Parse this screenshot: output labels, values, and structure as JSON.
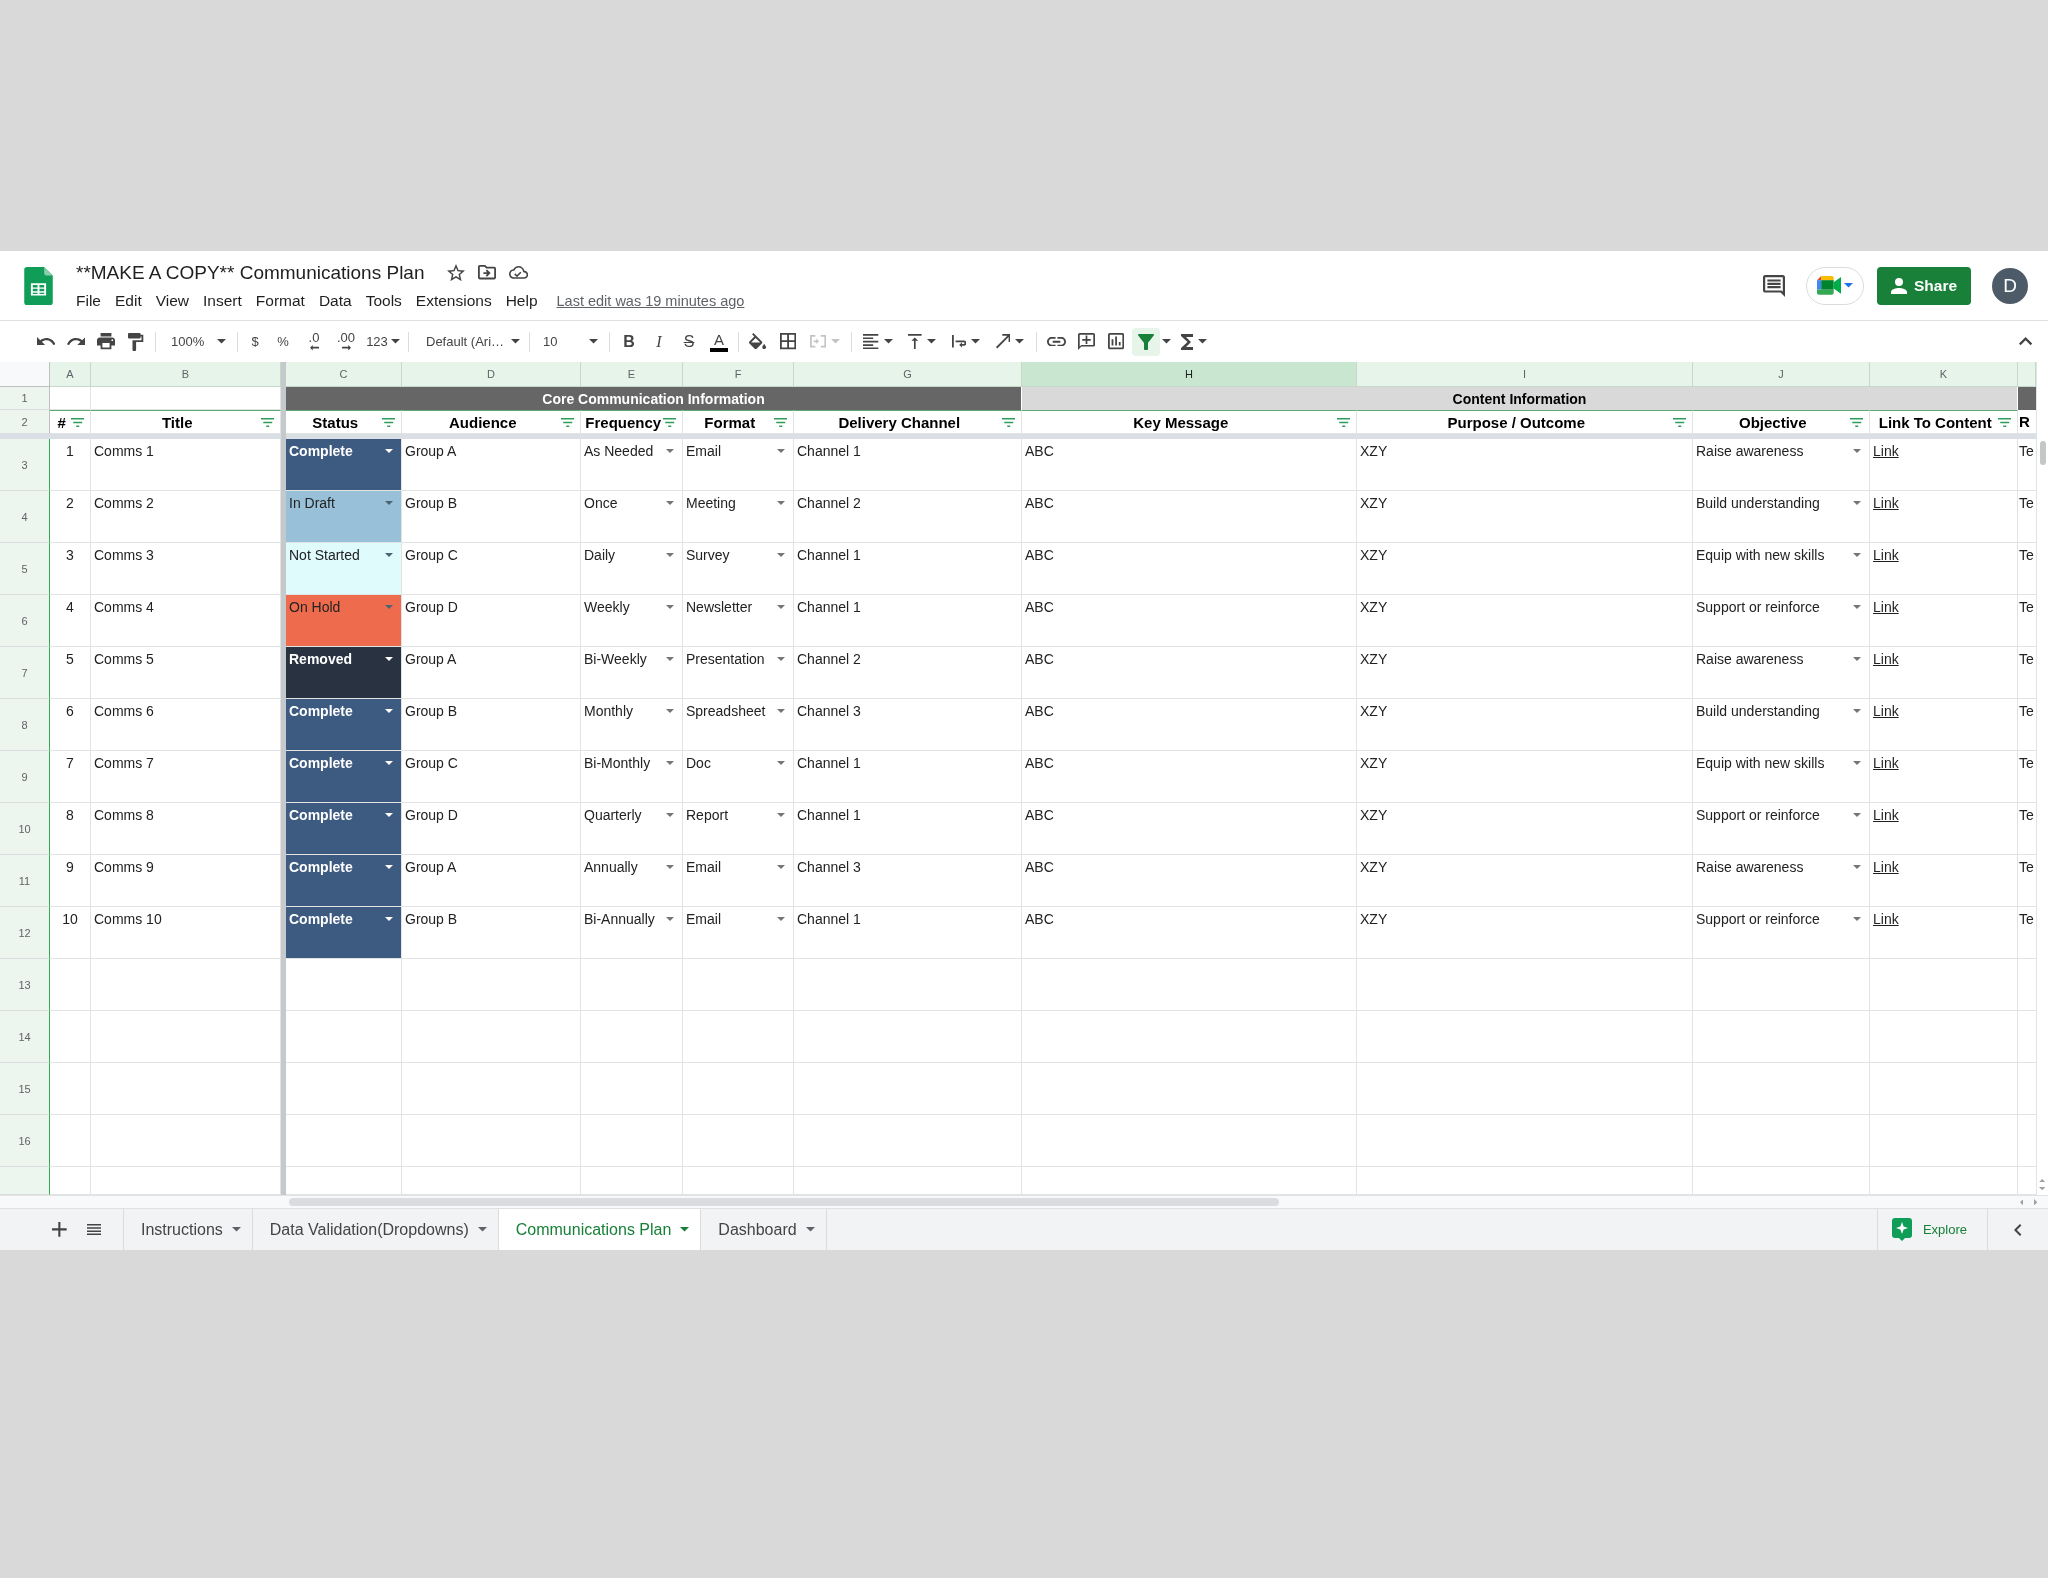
{
  "document": {
    "title": "**MAKE A COPY** Communications Plan",
    "starred": false,
    "last_edit": "Last edit was 19 minutes ago"
  },
  "menu": [
    "File",
    "Edit",
    "View",
    "Insert",
    "Format",
    "Data",
    "Tools",
    "Extensions",
    "Help"
  ],
  "share_button": "Share",
  "account": {
    "initial": "D"
  },
  "toolbar": {
    "zoom": "100%",
    "currency": "$",
    "percent": "%",
    "decrease_decimal": ".0",
    "increase_decimal": ".00",
    "number_format": "123",
    "font": "Default (Ari…",
    "font_size": "10",
    "bold": "B",
    "italic": "I",
    "strikethrough": "S",
    "text_color": "A",
    "merge_cells_disabled": true,
    "filter_on": true
  },
  "sheet": {
    "columns": [
      {
        "letter": "A",
        "selected": false
      },
      {
        "letter": "B",
        "selected": false
      },
      {
        "letter": "C",
        "selected": false
      },
      {
        "letter": "D",
        "selected": false
      },
      {
        "letter": "E",
        "selected": false
      },
      {
        "letter": "F",
        "selected": false
      },
      {
        "letter": "G",
        "selected": false
      },
      {
        "letter": "H",
        "selected": true
      },
      {
        "letter": "I",
        "selected": false
      },
      {
        "letter": "J",
        "selected": false
      },
      {
        "letter": "K",
        "selected": false
      }
    ],
    "group_row": {
      "row_number": "1",
      "groups": [
        {
          "label": "Core Communication Information",
          "kind": "dark"
        },
        {
          "label": "Content Information",
          "kind": "light"
        },
        {
          "kind": "dark"
        }
      ]
    },
    "header_row": {
      "row_number": "2",
      "headers": [
        {
          "label": "#",
          "filter": true
        },
        {
          "label": "Title",
          "filter": true
        },
        {
          "label": "Status",
          "filter": true
        },
        {
          "label": "Audience",
          "filter": true
        },
        {
          "label": "Frequency",
          "filter": true
        },
        {
          "label": "Format",
          "filter": true
        },
        {
          "label": "Delivery Channel",
          "filter": true
        },
        {
          "label": "Key Message",
          "filter": true
        },
        {
          "label": "Purpose / Outcome",
          "filter": true
        },
        {
          "label": "Objective",
          "filter": true
        },
        {
          "label": "Link To Content",
          "filter": true
        },
        {
          "label": "R",
          "filter": false
        }
      ]
    },
    "rows": [
      {
        "row_number": "3",
        "number": "1",
        "title": "Comms 1",
        "status": {
          "label": "Complete",
          "color": "#3d5a80"
        },
        "audience": "Group A",
        "frequency": "As Needed",
        "format": "Email",
        "delivery_channel": "Channel 1",
        "key_message": "ABC",
        "purpose_outcome": "XZY",
        "objective": "Raise awareness",
        "link": "Link",
        "column_12": "Te"
      },
      {
        "row_number": "4",
        "number": "2",
        "title": "Comms 2",
        "status": {
          "label": "In Draft",
          "color": "#98c1d9"
        },
        "audience": "Group B",
        "frequency": "Once",
        "format": "Meeting",
        "delivery_channel": "Channel 2",
        "key_message": "ABC",
        "purpose_outcome": "XZY",
        "objective": "Build understanding",
        "link": "Link",
        "column_12": "Te"
      },
      {
        "row_number": "5",
        "number": "3",
        "title": "Comms 3",
        "status": {
          "label": "Not Started",
          "color": "#e0fbfc"
        },
        "audience": "Group C",
        "frequency": "Daily",
        "format": "Survey",
        "delivery_channel": "Channel 1",
        "key_message": "ABC",
        "purpose_outcome": "XZY",
        "objective": "Equip with new skills",
        "link": "Link",
        "column_12": "Te"
      },
      {
        "row_number": "6",
        "number": "4",
        "title": "Comms 4",
        "status": {
          "label": "On Hold",
          "color": "#ee6c4d"
        },
        "audience": "Group D",
        "frequency": "Weekly",
        "format": "Newsletter",
        "delivery_channel": "Channel 1",
        "key_message": "ABC",
        "purpose_outcome": "XZY",
        "objective": "Support or reinforce",
        "link": "Link",
        "column_12": "Te"
      },
      {
        "row_number": "7",
        "number": "5",
        "title": "Comms 5",
        "status": {
          "label": "Removed",
          "color": "#293241"
        },
        "audience": "Group A",
        "frequency": "Bi-Weekly",
        "format": "Presentation",
        "delivery_channel": "Channel 2",
        "key_message": "ABC",
        "purpose_outcome": "XZY",
        "objective": "Raise awareness",
        "link": "Link",
        "column_12": "Te"
      },
      {
        "row_number": "8",
        "number": "6",
        "title": "Comms 6",
        "status": {
          "label": "Complete",
          "color": "#3d5a80"
        },
        "audience": "Group B",
        "frequency": "Monthly",
        "format": "Spreadsheet",
        "delivery_channel": "Channel 3",
        "key_message": "ABC",
        "purpose_outcome": "XZY",
        "objective": "Build understanding",
        "link": "Link",
        "column_12": "Te"
      },
      {
        "row_number": "9",
        "number": "7",
        "title": "Comms 7",
        "status": {
          "label": "Complete",
          "color": "#3d5a80"
        },
        "audience": "Group C",
        "frequency": "Bi-Monthly",
        "format": "Doc",
        "delivery_channel": "Channel 1",
        "key_message": "ABC",
        "purpose_outcome": "XZY",
        "objective": "Equip with new skills",
        "link": "Link",
        "column_12": "Te"
      },
      {
        "row_number": "10",
        "number": "8",
        "title": "Comms 8",
        "status": {
          "label": "Complete",
          "color": "#3d5a80"
        },
        "audience": "Group D",
        "frequency": "Quarterly",
        "format": "Report",
        "delivery_channel": "Channel 1",
        "key_message": "ABC",
        "purpose_outcome": "XZY",
        "objective": "Support or reinforce",
        "link": "Link",
        "column_12": "Te"
      },
      {
        "row_number": "11",
        "number": "9",
        "title": "Comms 9",
        "status": {
          "label": "Complete",
          "color": "#3d5a80"
        },
        "audience": "Group A",
        "frequency": "Annually",
        "format": "Email",
        "delivery_channel": "Channel 3",
        "key_message": "ABC",
        "purpose_outcome": "XZY",
        "objective": "Raise awareness",
        "link": "Link",
        "column_12": "Te"
      },
      {
        "row_number": "12",
        "number": "10",
        "title": "Comms 10",
        "status": {
          "label": "Complete",
          "color": "#3d5a80"
        },
        "audience": "Group B",
        "frequency": "Bi-Annually",
        "format": "Email",
        "delivery_channel": "Channel 1",
        "key_message": "ABC",
        "purpose_outcome": "XZY",
        "objective": "Support or reinforce",
        "link": "Link",
        "column_12": "Te"
      }
    ],
    "empty_rows": [
      "13",
      "14",
      "15",
      "16"
    ]
  },
  "sheet_tabs": [
    {
      "label": "Instructions",
      "selected": false
    },
    {
      "label": "Data Validation(Dropdowns)",
      "selected": false
    },
    {
      "label": "Communications Plan",
      "selected": true
    },
    {
      "label": "Dashboard",
      "selected": false
    }
  ],
  "explore_button": "Explore"
}
